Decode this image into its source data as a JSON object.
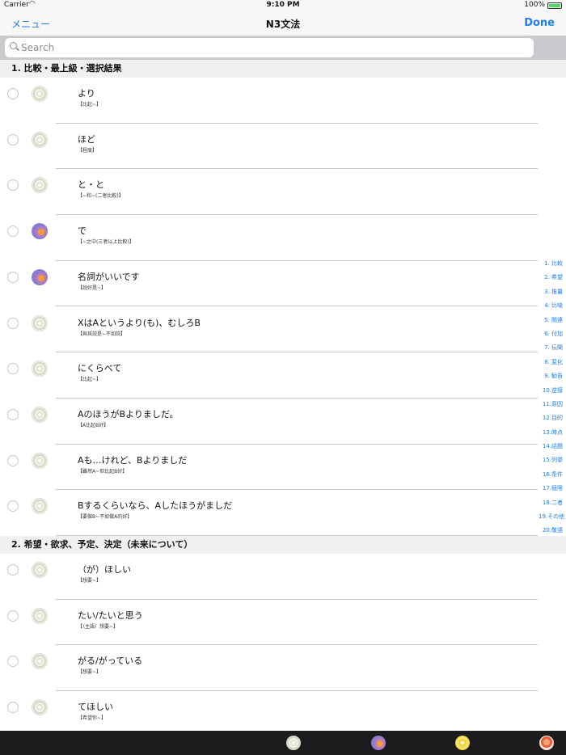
{
  "status": {
    "carrier": "Carrier",
    "time": "9:10 PM",
    "battery": "100%"
  },
  "nav": {
    "menu": "メニュー",
    "title": "N3文法",
    "done": "Done"
  },
  "search": {
    "placeholder": "Search"
  },
  "sections": [
    {
      "header": "1.   比較・最上級・選択結果",
      "items": [
        {
          "title": "より",
          "sub": "【比起~】",
          "icon": "grey-disc-icon"
        },
        {
          "title": "ほど",
          "sub": "【程度】",
          "icon": "grey-disc-icon"
        },
        {
          "title": "と・と",
          "sub": "【~和~(二者比較)】",
          "icon": "grey-disc-icon"
        },
        {
          "title": "で",
          "sub": "【~之中(三者以上比較)】",
          "icon": "purple-disc-icon"
        },
        {
          "title": "名詞がいいです",
          "sub": "【說好是~】",
          "icon": "purple-disc-icon"
        },
        {
          "title": "XはAというより(も)、むしろB",
          "sub": "【與其説是~不如説】",
          "icon": "grey-disc-icon"
        },
        {
          "title": "にくらべて",
          "sub": "【比起~】",
          "icon": "grey-disc-icon"
        },
        {
          "title": "AのほうがBよりましだ。",
          "sub": "【A比起B好】",
          "icon": "grey-disc-icon"
        },
        {
          "title": "Aも…けれど、Bよりましだ",
          "sub": "【雖然A~但比起B好】",
          "icon": "grey-disc-icon"
        },
        {
          "title": "Bするくらいなら、Aしたほうがましだ",
          "sub": "【要做B~不如做A的好】",
          "icon": "grey-disc-icon"
        }
      ]
    },
    {
      "header": "2.   希望・欲求、予定、決定（未来について）",
      "items": [
        {
          "title": "（が）ほしい",
          "sub": "【想要~】",
          "icon": "grey-disc-icon"
        },
        {
          "title": "たい/たいと思う",
          "sub": "【（主語）想要~】",
          "icon": "grey-disc-icon"
        },
        {
          "title": "がる/がっている",
          "sub": "【想要~】",
          "icon": "grey-disc-icon"
        },
        {
          "title": "てほしい",
          "sub": "【希望你~】",
          "icon": "grey-disc-icon"
        }
      ]
    }
  ],
  "index": [
    "1. 比較",
    "2. 希望",
    "3. 推量",
    "4. 比喩",
    "5. 関連",
    "6. 付加",
    "7. 伝聞",
    "8. 変化",
    "9. 勧告",
    "10.逆接",
    "11.原因",
    "12.目的",
    "13.時点",
    "14.話題",
    "15.列挙",
    "16.条件",
    "17.極限",
    "18.二者",
    "19.その他",
    "20.敬語"
  ],
  "tabs": [
    "grey-disc-icon",
    "purple-disc-icon",
    "yellow-disc-icon",
    "leaf-disc-icon"
  ]
}
